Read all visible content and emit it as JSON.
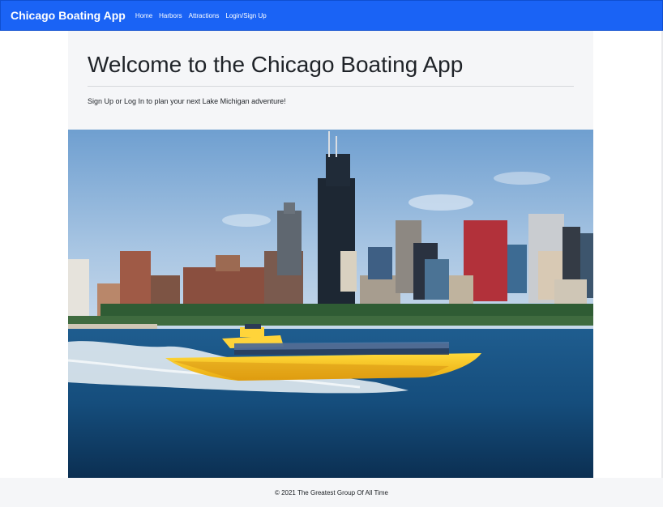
{
  "navbar": {
    "brand": "Chicago Boating App",
    "links": [
      "Home",
      "Harbors",
      "Attractions",
      "Login/Sign Up"
    ],
    "color": "#1a63f5"
  },
  "jumbotron": {
    "title": "Welcome to the Chicago Boating App",
    "lead": "Sign Up or Log In to plan your next Lake Michigan adventure!"
  },
  "hero_image": {
    "subject": "chicago-skyline-speedboat-photo"
  },
  "footer": {
    "text": "© 2021 The Greatest Group Of All Time"
  }
}
